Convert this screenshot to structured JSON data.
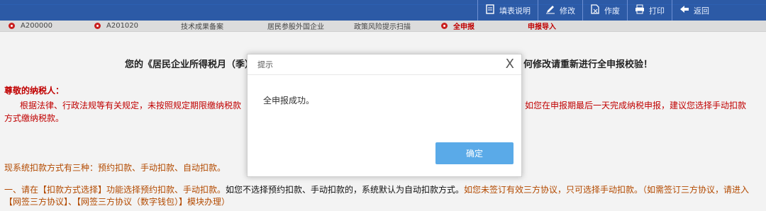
{
  "toolbar": {
    "items": [
      {
        "label": "填表说明",
        "icon": "document-icon"
      },
      {
        "label": "修改",
        "icon": "pencil-icon"
      },
      {
        "label": "作废",
        "icon": "void-document-icon"
      },
      {
        "label": "打印",
        "icon": "printer-icon"
      },
      {
        "label": "返回",
        "icon": "back-icon"
      }
    ]
  },
  "tabs": [
    {
      "label": "A200000"
    },
    {
      "label": "A201020"
    },
    {
      "label": "技术成果备案"
    },
    {
      "label": "居民参股外国企业"
    },
    {
      "label": "政策风险提示扫描"
    },
    {
      "label": "全申报"
    },
    {
      "label": "申报导入"
    }
  ],
  "content": {
    "headline_left": "您的《居民企业所得税月（季）",
    "headline_right": "何修改请重新进行全申报校验！",
    "salutation": "尊敬的纳税人：",
    "para_part1": "根据法律、行政法规等有关规定，未按照规定期限缴纳税款",
    "para_part2": "，如您在申报期最后一天完成纳税申报，建议您选择手动扣款",
    "para_part3": "方式缴纳税款。",
    "system_methods": "现系统扣款方式有三种：预约扣款、手动扣款、自动扣款。",
    "rule_part1": "一、请在【扣款方式选择】功能选择预约扣款、手动扣款。",
    "rule_part2": "如您不选择预约扣款、手动扣款的，系统默认为自动扣款方式。",
    "rule_part3": "如您未签订有效三方协议，只可选择手动扣款。（如需签订三方协议，请进入【网签三方协议】、【网签三方协议（数字钱包）】模块办理）"
  },
  "dialog": {
    "title": "提示",
    "close": "X",
    "message": "全申报成功。",
    "ok": "确定"
  },
  "colors": {
    "topbar": "#2c5aa6",
    "red_text": "#c00000",
    "orange_text": "#b34a00",
    "ok_button": "#5aaae8"
  }
}
